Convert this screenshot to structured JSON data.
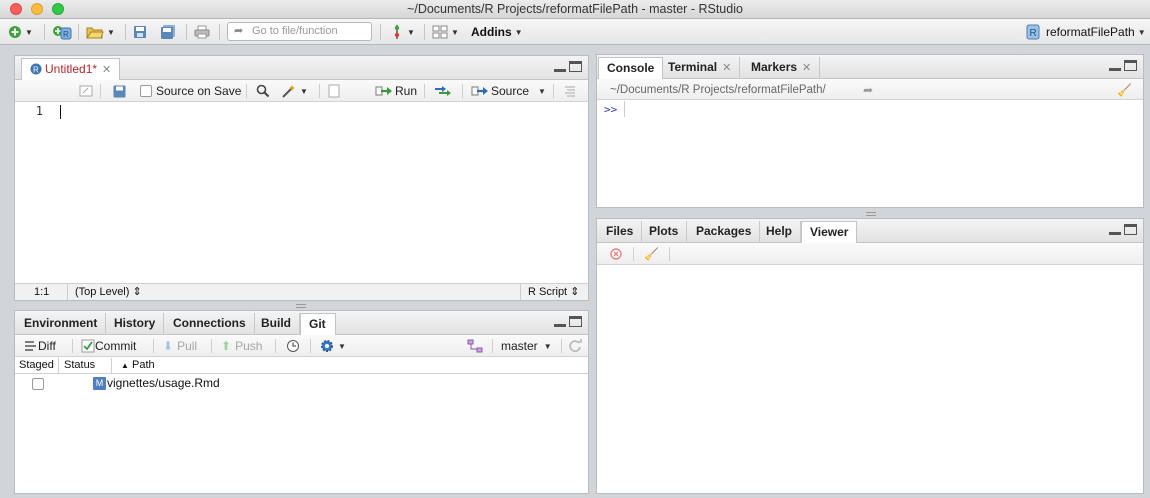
{
  "window": {
    "title": "~/Documents/R Projects/reformatFilePath - master - RStudio"
  },
  "toolbar": {
    "goto_placeholder": "Go to file/function",
    "addins_label": "Addins",
    "project_label": "reformatFilePath"
  },
  "editor": {
    "tab_label": "Untitled1*",
    "source_on_save": "Source on Save",
    "run_label": "Run",
    "source_label": "Source",
    "line_number": "1",
    "cursor_pos": "1:1",
    "scope": "(Top Level)",
    "file_type": "R Script"
  },
  "env_pane": {
    "tabs": [
      "Environment",
      "History",
      "Connections",
      "Build",
      "Git"
    ],
    "diff_label": "Diff",
    "commit_label": "Commit",
    "pull_label": "Pull",
    "push_label": "Push",
    "branch": "master",
    "columns": {
      "staged": "Staged",
      "status": "Status",
      "path": "Path"
    },
    "rows": [
      {
        "status": "M",
        "path": "vignettes/usage.Rmd"
      }
    ]
  },
  "console_pane": {
    "tabs": [
      "Console",
      "Terminal",
      "Markers"
    ],
    "path": "~/Documents/R Projects/reformatFilePath/",
    "prompt": ">>"
  },
  "files_pane": {
    "tabs": [
      "Files",
      "Plots",
      "Packages",
      "Help",
      "Viewer"
    ]
  },
  "colors": {
    "accent": "#2d6eb8",
    "tab_modified": "#b2262f",
    "git_modified": "#4f7fbf"
  }
}
